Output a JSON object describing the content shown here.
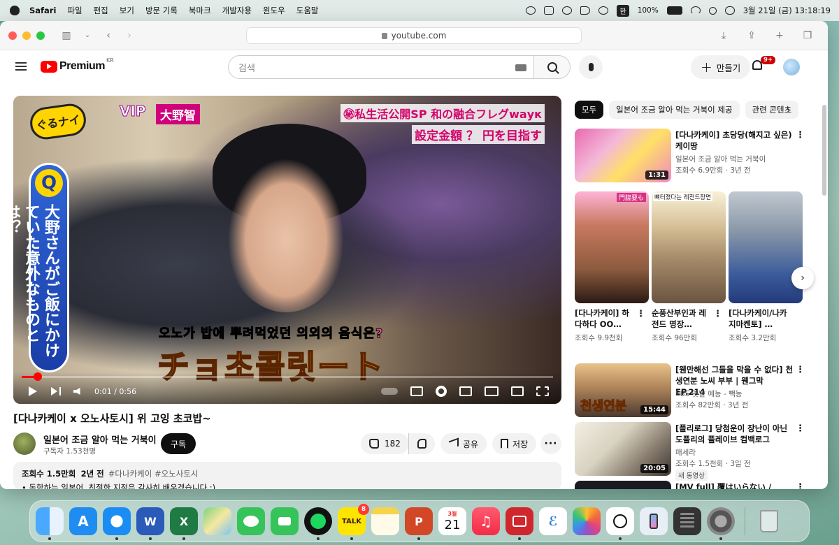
{
  "menubar": {
    "app_name": "Safari",
    "items": [
      "파일",
      "편집",
      "보기",
      "방문 기록",
      "북마크",
      "개발자용",
      "윈도우",
      "도움말"
    ],
    "input_source": "한",
    "battery": "100%",
    "datetime": "3월 21일 (금) 13:18:19"
  },
  "browser": {
    "url": "youtube.com"
  },
  "yt_header": {
    "logo_text": "Premium",
    "region": "KR",
    "search_placeholder": "검색",
    "create_label": "만들기",
    "notif_count": "9+"
  },
  "player": {
    "overlay": {
      "show_logo": "ぐるナイ",
      "vip_label": "VIP",
      "vip_name": "大野智",
      "q_letter": "Q",
      "vertical_question": "大野さんがご飯にかけていた意外なものとは？",
      "top_line1": "㊙私生活公開SP 和の融合フレグwaук",
      "top_line2": "設定金額 ？ 円を目指す",
      "sub_small_pre": "오노가 밥에 뿌려먹었던 ",
      "sub_small_hl": "의외의 음식은?",
      "sub_big": "チョ초콜릿ート"
    },
    "time": "0:01 / 0:56",
    "progress": 0.03
  },
  "video": {
    "title": "[다나카케이 x 오노사토시] 위 고잉 초코밥~",
    "channel": "일본어 조금 알아 먹는 거북이",
    "subscribers": "구독자 1.53천명",
    "subscribe_label": "구독",
    "likes": "182",
    "share_label": "공유",
    "save_label": "저장",
    "views": "조회수 1.5만회",
    "age": "2년 전",
    "tags": "#다나카케이 #오노사토시",
    "desc_line": "• 독학하는 일본어, 친절한 지적은 감사히 배우겠습니다 :)"
  },
  "chips": [
    "모두",
    "일본어 조금 알아 먹는 거북이 제공",
    "관련 콘텐츠"
  ],
  "recs": [
    {
      "title": "[다나카케이] 초당당(해지고 싶은) 케이땅",
      "channel": "일본어 조금 알아 먹는 거북이",
      "meta": "조회수 6.9만회 · 3년 전",
      "duration": "1:31"
    },
    {
      "title": "[웬만해선 그들을 막을 수 없다] 천생연분 노씨 부부 | 웬그막 EP.214",
      "channel": "SBS 옛날 예능 - 빽능",
      "meta": "조회수 82만회 · 3년 전",
      "duration": "15:44",
      "thumb_text": "천생연분"
    },
    {
      "title": "[플리로그] 당첨운이 장난이 아닌 도플리의 플레이브 컴백로그",
      "channel": "매세라",
      "meta": "조회수 1.5천회 · 3일 전",
      "duration": "20:05",
      "new_badge": "새 동영상"
    },
    {
      "title": "[MV full] 覆はいらない /"
    }
  ],
  "shorts": [
    {
      "title": "[다나카케이] 하다하다 OO…",
      "views": "조회수 9.9천회",
      "label": "門脇要も"
    },
    {
      "title": "순풍산부인과 레전드 명장…",
      "views": "조회수 96만회",
      "label": "뼈터졌다는 레전드장면"
    },
    {
      "title": "[다나카케이/나카지마켄토] …",
      "views": "조회수 3.2만회",
      "label": ""
    }
  ],
  "dock": {
    "calendar_month": "3월",
    "calendar_day": "21",
    "talk_label": "TALK",
    "talk_badge": "8"
  }
}
